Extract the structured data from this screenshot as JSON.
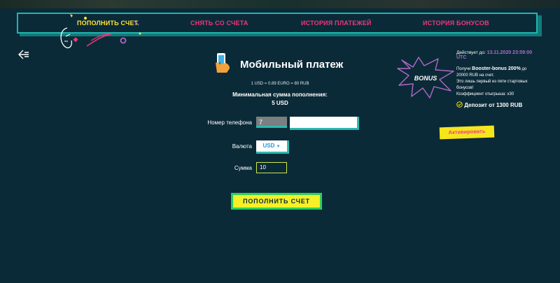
{
  "tabs": [
    {
      "label": "ПОПОЛНИТЬ СЧЕТ",
      "active": true
    },
    {
      "label": "СНЯТЬ СО СЧЕТА",
      "active": false
    },
    {
      "label": "ИСТОРИЯ ПЛАТЕЖЕЙ",
      "active": false
    },
    {
      "label": "ИСТОРИЯ БОНУСОВ",
      "active": false
    }
  ],
  "payment": {
    "title": "Мобильный платеж",
    "rate": "1 USD = 0.89 EURO = 80 RUB",
    "min_label": "Минимальная сумма пополнения:",
    "min_value": "5 USD",
    "phone_label": "Номер телефона",
    "phone_prefix": "7",
    "phone_value": "",
    "currency_label": "Валюта",
    "currency_value": "USD",
    "amount_label": "Сумма",
    "amount_value": "10",
    "submit_label": "ПОПОЛНИТЬ СЧЕТ"
  },
  "bonus": {
    "badge": "BONUS",
    "valid_prefix": "Действует до:",
    "valid_date": "13.11.2020 23:59:00",
    "valid_tz": "UTC",
    "line1_prefix": "Получи",
    "line1_bold": "Booster-bonus 200%",
    "line1_suffix": "до",
    "line2": "20000 RUB на счет.",
    "line3": "Это лишь первый из пяти стартовых",
    "line4": "бонусов!",
    "line5": "Коэффициент отыгрыша: x30",
    "deposit": "Депозит от 1300 RUB",
    "activate_label": "Активировать"
  },
  "colors": {
    "background": "#0b2a38",
    "accent_teal": "#1fb5b0",
    "active_tab": "#ffe632",
    "inactive_tab": "#f2367a",
    "button": "#f5f028",
    "bonus_date": "#b06ac5"
  },
  "icons": [
    "back-arrow-icon",
    "phone-hand-icon",
    "chevron-down-icon",
    "check-circle-icon",
    "bonus-star-icon",
    "mascot-decoration-icon"
  ]
}
